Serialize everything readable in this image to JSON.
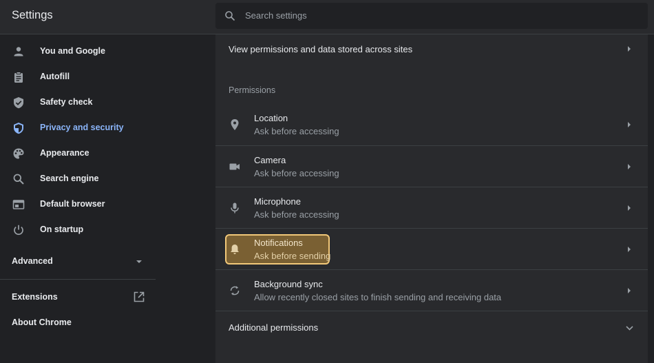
{
  "header": {
    "title": "Settings",
    "search_placeholder": "Search settings"
  },
  "sidebar": {
    "items": [
      {
        "label": "You and Google",
        "icon": "person-icon"
      },
      {
        "label": "Autofill",
        "icon": "clipboard-icon"
      },
      {
        "label": "Safety check",
        "icon": "shield-check-icon"
      },
      {
        "label": "Privacy and security",
        "icon": "shield-icon",
        "active": true
      },
      {
        "label": "Appearance",
        "icon": "palette-icon"
      },
      {
        "label": "Search engine",
        "icon": "search-icon"
      },
      {
        "label": "Default browser",
        "icon": "browser-icon"
      },
      {
        "label": "On startup",
        "icon": "power-icon"
      }
    ],
    "advanced_label": "Advanced",
    "extensions_label": "Extensions",
    "about_label": "About Chrome"
  },
  "main": {
    "view_permissions_label": "View permissions and data stored across sites",
    "permissions_heading": "Permissions",
    "permissions": [
      {
        "title": "Location",
        "subtitle": "Ask before accessing",
        "icon": "location-pin-icon"
      },
      {
        "title": "Camera",
        "subtitle": "Ask before accessing",
        "icon": "camera-icon"
      },
      {
        "title": "Microphone",
        "subtitle": "Ask before accessing",
        "icon": "microphone-icon"
      },
      {
        "title": "Notifications",
        "subtitle": "Ask before sending",
        "icon": "bell-icon",
        "highlighted": true
      },
      {
        "title": "Background sync",
        "subtitle": "Allow recently closed sites to finish sending and receiving data",
        "icon": "sync-icon"
      }
    ],
    "additional_permissions_label": "Additional permissions"
  },
  "colors": {
    "background": "#202124",
    "card": "#292a2d",
    "accent": "#8ab4f8",
    "highlight_fill": "#7a6033",
    "highlight_border": "#f2c879"
  }
}
